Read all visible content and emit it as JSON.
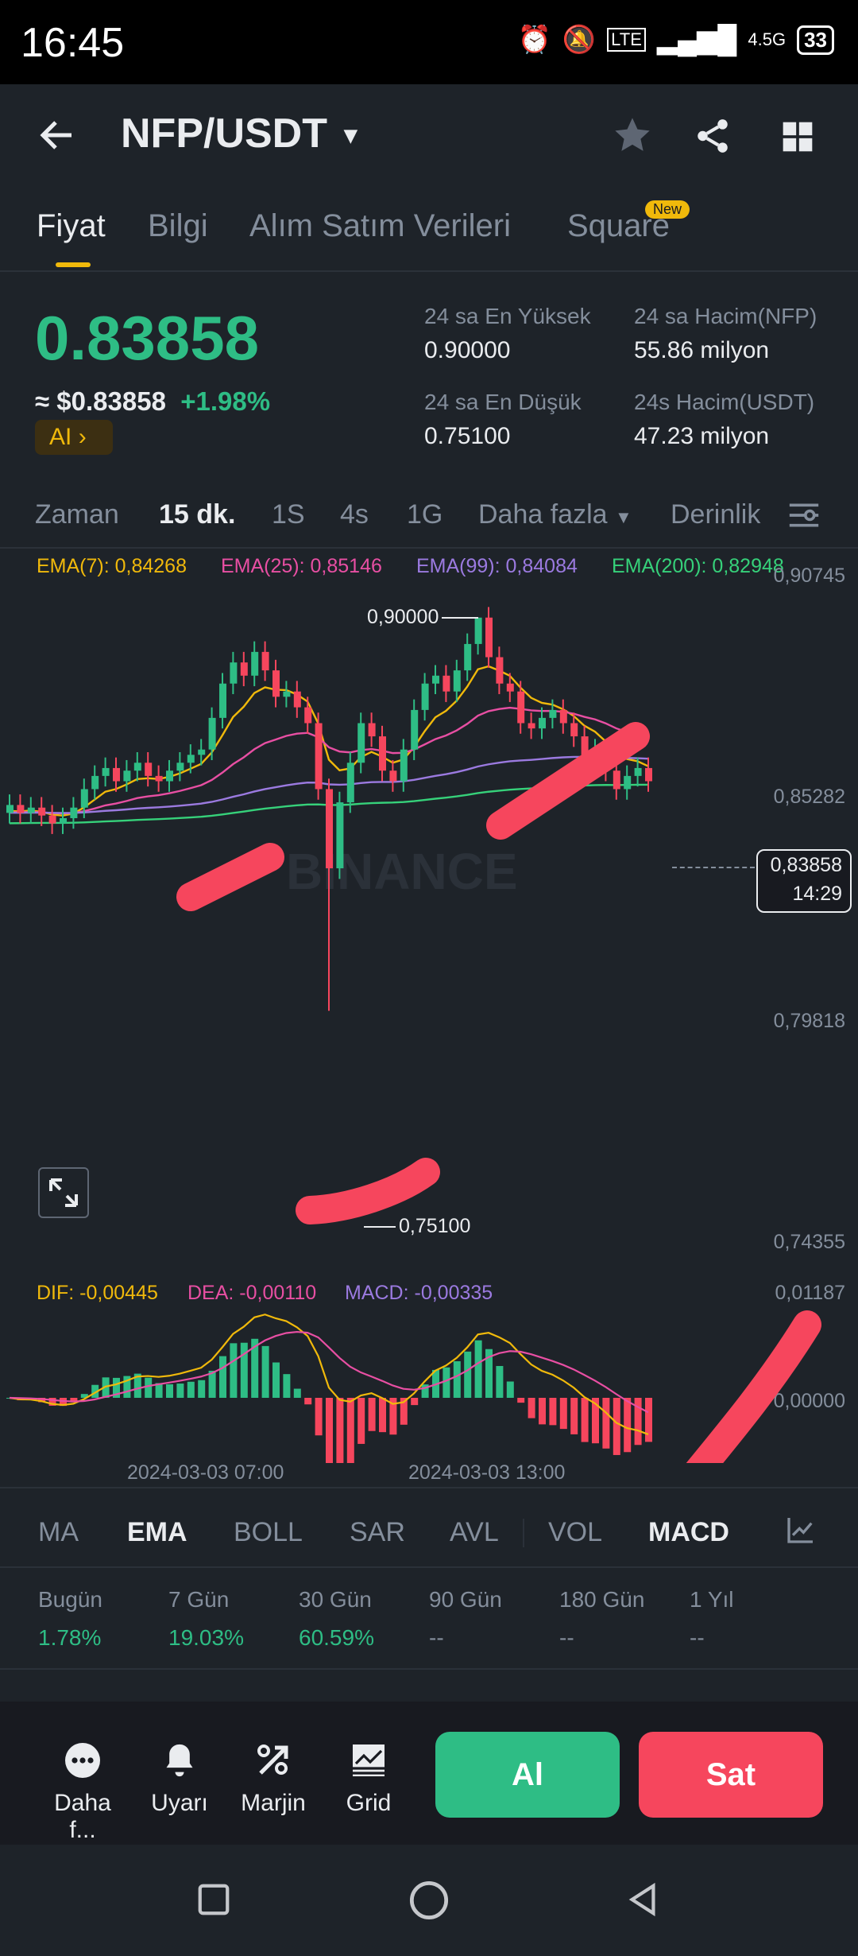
{
  "status": {
    "time": "16:45",
    "battery": "33",
    "network": "4.5G"
  },
  "header": {
    "title": "NFP/USDT"
  },
  "tabs": [
    {
      "label": "Fiyat",
      "active": true
    },
    {
      "label": "Bilgi"
    },
    {
      "label": "Alım Satım Verileri"
    },
    {
      "label": "Square",
      "badge": "New"
    }
  ],
  "price": {
    "last": "0.83858",
    "approx": "≈ $0.83858",
    "change": "+1.98%",
    "ai_label": "AI"
  },
  "stats": {
    "high_label": "24 sa En Yüksek",
    "high_value": "0.90000",
    "low_label": "24 sa En Düşük",
    "low_value": "0.75100",
    "vol_nfp_label": "24 sa Hacim(NFP)",
    "vol_nfp_value": "55.86 milyon",
    "vol_usdt_label": "24s Hacim(USDT)",
    "vol_usdt_value": "47.23 milyon"
  },
  "timeframes": [
    "Zaman",
    "15 dk.",
    "1S",
    "4s",
    "1G",
    "Daha fazla",
    "Derinlik"
  ],
  "active_timeframe": "15 dk.",
  "ema_legend": [
    {
      "label": "EMA(7): 0,84268",
      "color": "#f0b90b"
    },
    {
      "label": "EMA(25): 0,85146",
      "color": "#e84fa3"
    },
    {
      "label": "EMA(99): 0,84084",
      "color": "#9b7ae0"
    },
    {
      "label": "EMA(200): 0,82948",
      "color": "#36d17a"
    }
  ],
  "price_axis": [
    "0,90745",
    "0,85282",
    "0,79818",
    "0,74355"
  ],
  "markers": {
    "high": "0,90000",
    "low": "0,75100"
  },
  "current_tag": {
    "price": "0,83858",
    "countdown": "14:29"
  },
  "watermark": "BINANCE",
  "macd_legend": [
    {
      "label": "DIF: -0,00445",
      "color": "#f0b90b"
    },
    {
      "label": "DEA: -0,00110",
      "color": "#e84fa3"
    },
    {
      "label": "MACD: -0,00335",
      "color": "#9b7ae0"
    }
  ],
  "macd_axis": [
    "0,01187",
    "0,00000"
  ],
  "time_axis": [
    "2024-03-03 07:00",
    "2024-03-03 13:00"
  ],
  "indicators": [
    "MA",
    "EMA",
    "BOLL",
    "SAR",
    "AVL",
    "VOL",
    "MACD"
  ],
  "active_indicators": [
    "EMA",
    "MACD"
  ],
  "performance": [
    {
      "label": "Bugün",
      "value": "1.78%"
    },
    {
      "label": "7 Gün",
      "value": "19.03%"
    },
    {
      "label": "30 Gün",
      "value": "60.59%"
    },
    {
      "label": "90 Gün",
      "value": "--"
    },
    {
      "label": "180 Gün",
      "value": "--"
    },
    {
      "label": "1 Yıl",
      "value": "--"
    }
  ],
  "bottom": {
    "more": "Daha f...",
    "alert": "Uyarı",
    "margin": "Marjin",
    "grid": "Grid",
    "buy": "Al",
    "sell": "Sat"
  },
  "chart_data": {
    "type": "candlestick",
    "symbol": "NFP/USDT",
    "interval": "15 dk.",
    "high_marker": 0.9,
    "low_marker": 0.751,
    "last": 0.83858,
    "ylim": [
      0.74355,
      0.90745
    ],
    "close_values": [
      0.829,
      0.826,
      0.828,
      0.825,
      0.822,
      0.824,
      0.828,
      0.835,
      0.84,
      0.843,
      0.838,
      0.842,
      0.845,
      0.84,
      0.838,
      0.842,
      0.845,
      0.848,
      0.85,
      0.862,
      0.875,
      0.883,
      0.878,
      0.887,
      0.88,
      0.87,
      0.872,
      0.866,
      0.86,
      0.835,
      0.805,
      0.83,
      0.845,
      0.86,
      0.855,
      0.842,
      0.838,
      0.85,
      0.865,
      0.875,
      0.878,
      0.872,
      0.88,
      0.89,
      0.9,
      0.885,
      0.875,
      0.872,
      0.86,
      0.858,
      0.862,
      0.865,
      0.86,
      0.855,
      0.848,
      0.85,
      0.842,
      0.835,
      0.84,
      0.843,
      0.838
    ]
  }
}
